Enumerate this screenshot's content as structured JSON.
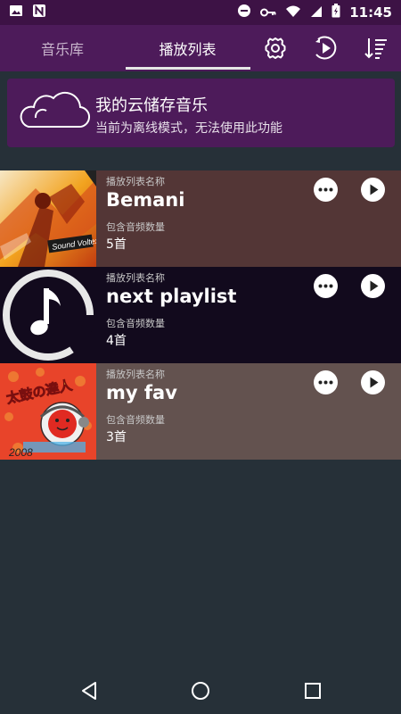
{
  "status_bar": {
    "time": "11:45",
    "icons": [
      "image-icon",
      "n-icon",
      "dnd-icon",
      "key-icon",
      "wifi-icon",
      "signal-icon",
      "battery-icon"
    ]
  },
  "tabs": [
    {
      "label": "音乐库",
      "selected": false
    },
    {
      "label": "播放列表",
      "selected": true
    }
  ],
  "toolbar": {
    "icons": [
      "settings-icon",
      "play-circle-icon",
      "sort-icon"
    ]
  },
  "cloud": {
    "title": "我的云储存音乐",
    "subtitle": "当前为离线模式，无法使用此功能"
  },
  "playlists": [
    {
      "name_label": "播放列表名称",
      "name": "Bemani",
      "count_label": "包含音频数量",
      "count": "5首",
      "bg": "#533636",
      "cover": "bemani"
    },
    {
      "name_label": "播放列表名称",
      "name": "next playlist",
      "count_label": "包含音频数量",
      "count": "4首",
      "bg": "#120a1d",
      "cover": "music-note"
    },
    {
      "name_label": "播放列表名称",
      "name": "my fav",
      "count_label": "包含音频数量",
      "count": "3首",
      "bg": "#63524f",
      "cover": "taiko"
    }
  ],
  "cover_texts": {
    "bemani": "Sound Voltex / Dance Mania",
    "taiko": "太鼓の達人"
  },
  "nav_bar": {
    "icons": [
      "back-icon",
      "home-icon",
      "recents-icon"
    ]
  },
  "colors": {
    "header": "#4d1b5a",
    "status": "#3d1245",
    "background": "#263038"
  }
}
